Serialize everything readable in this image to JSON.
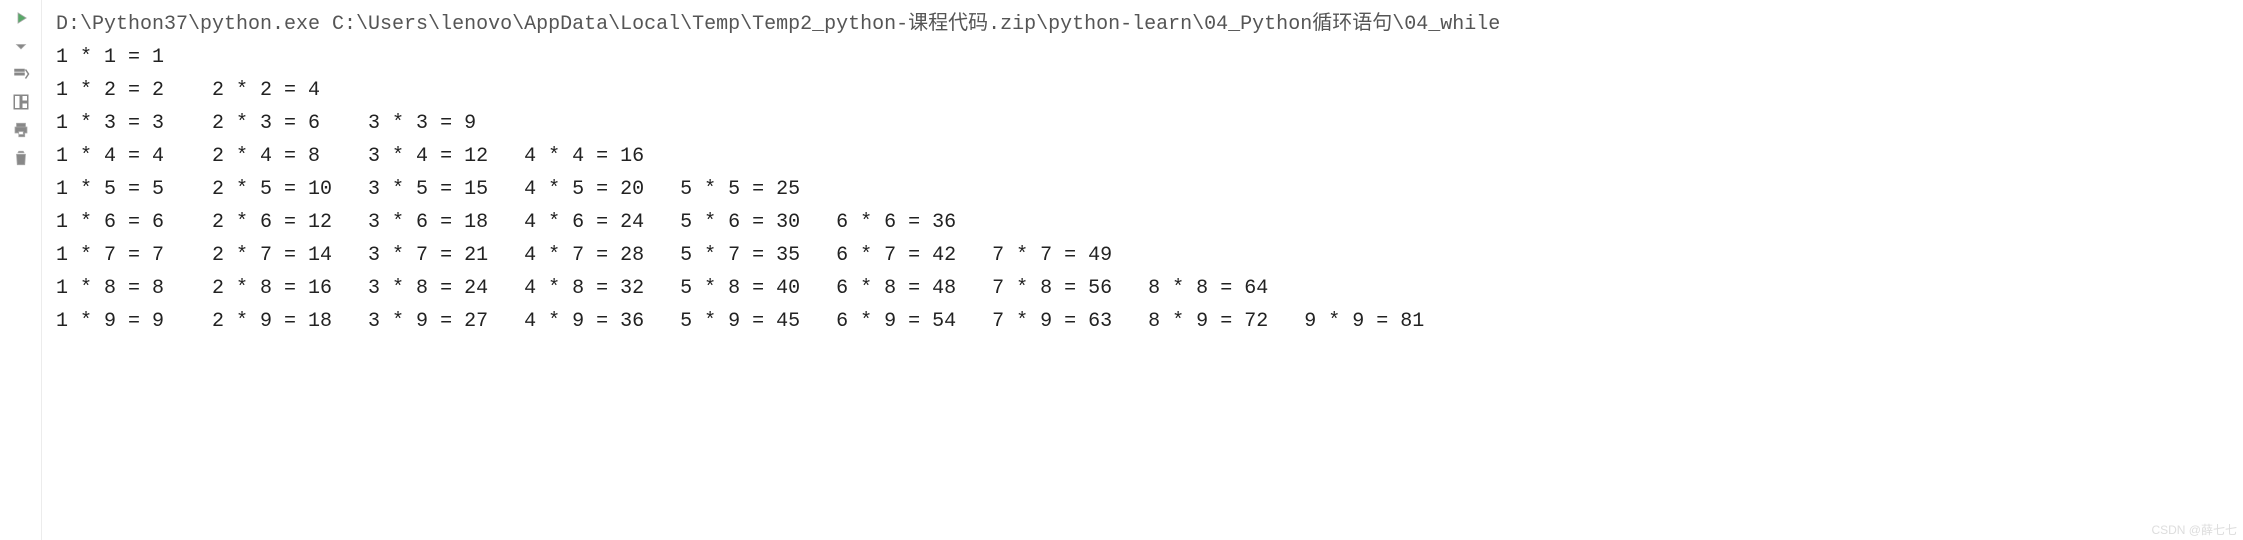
{
  "gutter": {
    "icons": [
      "run-arrow-icon",
      "down-arrow-icon",
      "step-icon",
      "layout-icon",
      "print-icon",
      "trash-icon"
    ]
  },
  "command_line": "D:\\Python37\\python.exe C:\\Users\\lenovo\\AppData\\Local\\Temp\\Temp2_python-课程代码.zip\\python-learn\\04_Python循环语句\\04_while",
  "output_lines": [
    "1 * 1 = 1",
    "1 * 2 = 2    2 * 2 = 4",
    "1 * 3 = 3    2 * 3 = 6    3 * 3 = 9",
    "1 * 4 = 4    2 * 4 = 8    3 * 4 = 12   4 * 4 = 16",
    "1 * 5 = 5    2 * 5 = 10   3 * 5 = 15   4 * 5 = 20   5 * 5 = 25",
    "1 * 6 = 6    2 * 6 = 12   3 * 6 = 18   4 * 6 = 24   5 * 6 = 30   6 * 6 = 36",
    "1 * 7 = 7    2 * 7 = 14   3 * 7 = 21   4 * 7 = 28   5 * 7 = 35   6 * 7 = 42   7 * 7 = 49",
    "1 * 8 = 8    2 * 8 = 16   3 * 8 = 24   4 * 8 = 32   5 * 8 = 40   6 * 8 = 48   7 * 8 = 56   8 * 8 = 64",
    "1 * 9 = 9    2 * 9 = 18   3 * 9 = 27   4 * 9 = 36   5 * 9 = 45   6 * 9 = 54   7 * 9 = 63   8 * 9 = 72   9 * 9 = 81"
  ],
  "watermark": "CSDN @薛七七"
}
